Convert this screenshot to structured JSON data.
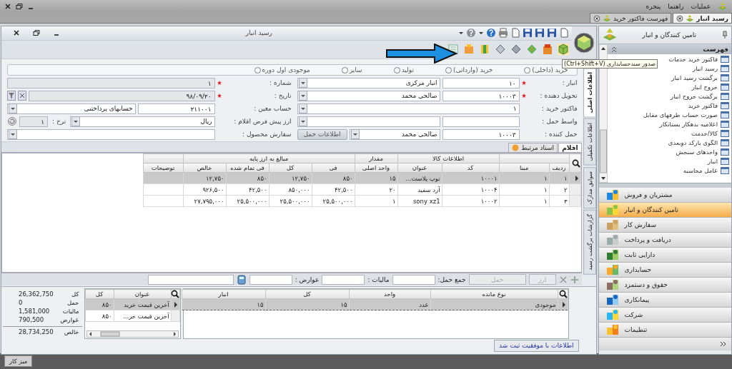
{
  "menu": [
    {
      "label": "عملیات"
    },
    {
      "label": "راهنما"
    },
    {
      "label": "پنجره"
    }
  ],
  "doc_tabs": [
    {
      "label": "رسید انبار",
      "selected": true
    },
    {
      "label": "فهرست فاکتور خرید",
      "selected": false
    }
  ],
  "document": {
    "title": "رسید انبار",
    "tooltip": "صدور سندحسابداری (Ctrl+Shift+V)",
    "receipt_types": [
      {
        "label": "خرید (داخلی)",
        "selected": false
      },
      {
        "label": "خرید (وارداتی)",
        "selected": false
      },
      {
        "label": "تولید",
        "selected": false
      },
      {
        "label": "سایر",
        "selected": false
      },
      {
        "label": "موجودی اول دوره",
        "selected": false
      }
    ],
    "form_rows": [
      {
        "right": {
          "label": "انبار :",
          "required": true,
          "controls": [
            {
              "kind": "input",
              "value": "۱۰"
            },
            {
              "kind": "combo",
              "value": "انبار مرکزی"
            }
          ]
        },
        "left": {
          "label": "شماره :",
          "required": true,
          "controls": [
            {
              "kind": "readonly",
              "value": "۱"
            }
          ]
        }
      },
      {
        "right": {
          "label": "تحویل دهنده :",
          "required": true,
          "controls": [
            {
              "kind": "input",
              "value": "۱۰۰۰۳"
            },
            {
              "kind": "combo",
              "value": "صالحی محمد"
            }
          ]
        },
        "left": {
          "label": "تاریخ :",
          "required": true,
          "controls": [
            {
              "kind": "date",
              "value": "۹۸/۰۹/۲۰"
            }
          ]
        }
      },
      {
        "right": {
          "label": "فاکتور خرید :",
          "required": false,
          "controls": [
            {
              "kind": "combo",
              "value": "۱"
            }
          ]
        },
        "left": {
          "label": "حساب معین :",
          "required": false,
          "controls": [
            {
              "kind": "input",
              "value": "۲۱۱۰۰۱"
            },
            {
              "kind": "combo",
              "value": "حسابهای پرداختنی"
            }
          ]
        }
      },
      {
        "right": {
          "label": "واسط حمل :",
          "required": false,
          "controls": [
            {
              "kind": "input"
            },
            {
              "kind": "combo"
            }
          ]
        },
        "left": {
          "label": "ارز پیش فرض اقلام :",
          "required": false,
          "controls": [
            {
              "kind": "combo",
              "value": "ریال"
            },
            {
              "kind": "label",
              "value": "نرخ :"
            },
            {
              "kind": "rate",
              "value": "۱"
            }
          ]
        }
      },
      {
        "right": {
          "label": "حمل کننده :",
          "required": false,
          "controls": [
            {
              "kind": "input",
              "value": "۱۰۰۰۳"
            },
            {
              "kind": "combo",
              "value": "صالحی محمد"
            },
            {
              "kind": "button",
              "value": "اطلاعات حمل"
            }
          ]
        },
        "left": {
          "label": "سفارش محصول :",
          "required": false,
          "controls": [
            {
              "kind": "combo"
            }
          ]
        }
      }
    ],
    "side_tabs": [
      {
        "label": "اطلاعات اصلی",
        "selected": true
      },
      {
        "label": "اطلاعات تکمیلی",
        "selected": false
      },
      {
        "label": "سوابق مدارک",
        "selected": false
      },
      {
        "label": "گزارشات برگشت رسید",
        "selected": false
      }
    ],
    "item_tabs": [
      {
        "label": "اقلام",
        "selected": true
      },
      {
        "label": "اسناد مرتبط",
        "selected": false
      }
    ],
    "items_table": {
      "column_groups": [
        {
          "columns": [
            "ردیف",
            "مبنا"
          ]
        },
        {
          "label": "اطلاعات کالا",
          "columns": [
            "کد",
            "عنوان"
          ]
        },
        {
          "label": "مقدار",
          "columns": [
            "واحد اصلی"
          ]
        },
        {
          "label": "مبالغ به ارز پایه",
          "columns": [
            "فی",
            "کل",
            "فی تمام شده",
            "خالص"
          ]
        },
        {
          "columns": [
            "توضیحات"
          ]
        }
      ],
      "rows": [
        {
          "selected": true,
          "cells": [
            "۱",
            "۱",
            "۱۰۰۰۱",
            "توپ پلاست...",
            "۱۵",
            "۸۵۰",
            "۱۲,۷۵۰",
            "۸۵۰",
            "۱۲,۷۵۰",
            ""
          ]
        },
        {
          "selected": false,
          "cells": [
            "۲",
            "۱",
            "۱۰۰۰۴",
            "آرد سفید",
            "۲۰",
            "۴۲,۵۰۰",
            "۸۵۰,۰۰۰",
            "۴۲,۵۰۰",
            "۹۲۶,۵۰۰",
            ""
          ]
        },
        {
          "selected": false,
          "cells": [
            "۳",
            "۱",
            "۱۰۰۰۲",
            "sony xz1",
            "۱",
            "۲۵,۵۰۰,۰۰۰",
            "۲۵,۵۰۰,۰۰۰",
            "۲۵,۵۰۰,۰۰۰",
            "۲۷,۷۹۵,۰۰۰",
            ""
          ]
        }
      ]
    },
    "item_toolbar": {
      "buttons": [
        {
          "label": "ارز",
          "disabled": true
        },
        {
          "label": "حمل",
          "disabled": true
        }
      ],
      "fields": [
        {
          "label": "جمع حمل:"
        },
        {
          "label": "مالیات :"
        },
        {
          "label": "عوارض :"
        }
      ]
    },
    "stock_table": {
      "columns": [
        "نوع مانده",
        "واحد",
        "کل",
        "انبار"
      ],
      "rows": [
        {
          "selected": true,
          "cells": [
            "موجودی",
            "عدد",
            "۱۵",
            "۱۵"
          ]
        }
      ]
    },
    "price_table": {
      "columns": [
        "عنوان",
        "کل"
      ],
      "rows": [
        {
          "selected": true,
          "cells": [
            "آخرین قیمت خرید",
            "۸۵۰"
          ]
        },
        {
          "selected": false,
          "cells": [
            "آخرین قیمت خر...",
            "۸۵۰"
          ]
        }
      ]
    },
    "totals": [
      {
        "label": "کل",
        "value": "26,362,750"
      },
      {
        "label": "حمل",
        "value": "0"
      },
      {
        "label": "مالیات",
        "value": "1,581,000"
      },
      {
        "label": "عوارض",
        "value": "790,500"
      },
      {
        "label": "خالص",
        "value": "28,734,250"
      }
    ],
    "message": "اطلاعات با موفقیت ثبت شد"
  },
  "side_panel": {
    "title": "تامین کنندگان و انبار",
    "list_title": "فهرست",
    "list_items": [
      "فاکتور خرید خدمات",
      "رسید انبار",
      "برگشت رسید انبار",
      "خروج انبار",
      "برگشت خروج انبار",
      "فاکتور خرید",
      "صورت حساب طرفهای مقابل",
      "اعلامیه بدهکار بستانکار",
      "کالا/خدمت",
      "الگوی بارکد دوبعدی",
      "واحدهای سنجش",
      "انبار",
      "عامل محاسبه"
    ],
    "modules": [
      {
        "label": "مشتریان و فروش",
        "selected": false
      },
      {
        "label": "تامین کنندگان و انبار",
        "selected": true
      },
      {
        "label": "سفارش کار",
        "selected": false
      },
      {
        "label": "دریافت و پرداخت",
        "selected": false
      },
      {
        "label": "دارایی ثابت",
        "selected": false
      },
      {
        "label": "حسابداری",
        "selected": false
      },
      {
        "label": "حقوق و دستمزد",
        "selected": false
      },
      {
        "label": "پیمانکاری",
        "selected": false
      },
      {
        "label": "شرکت",
        "selected": false
      },
      {
        "label": "تنظیمات",
        "selected": false
      }
    ]
  },
  "status_bar": {
    "button": "میز کار"
  }
}
